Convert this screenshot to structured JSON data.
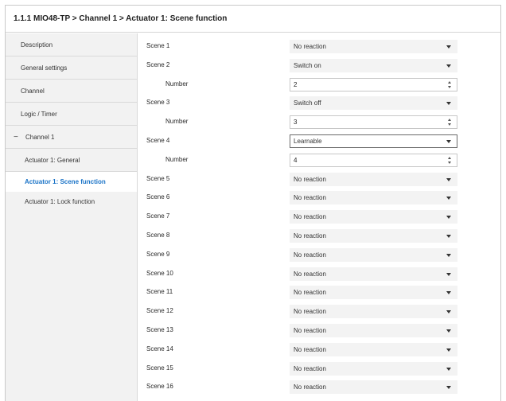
{
  "header": {
    "title": "1.1.1 MIO48-TP > Channel 1 > Actuator 1: Scene function"
  },
  "sidebar": {
    "items": [
      {
        "label": "Description"
      },
      {
        "label": "General settings"
      },
      {
        "label": "Channel"
      },
      {
        "label": "Logic / Timer"
      },
      {
        "label": "Channel 1",
        "collapse_sign": "−"
      },
      {
        "label": "Actuator 1: General"
      },
      {
        "label": "Actuator 1: Scene function",
        "active": true
      },
      {
        "label": "Actuator 1: Lock function"
      }
    ]
  },
  "content": {
    "rows": [
      {
        "label": "Scene 1",
        "type": "select",
        "value": "No reaction"
      },
      {
        "label": "Scene 2",
        "type": "select",
        "value": "Switch on"
      },
      {
        "label": "Number",
        "type": "spin",
        "value": "2"
      },
      {
        "label": "Scene 3",
        "type": "select",
        "value": "Switch off"
      },
      {
        "label": "Number",
        "type": "spin",
        "value": "3"
      },
      {
        "label": "Scene 4",
        "type": "select",
        "value": "Learnable",
        "focused": true
      },
      {
        "label": "Number",
        "type": "spin",
        "value": "4"
      },
      {
        "label": "Scene 5",
        "type": "select",
        "value": "No reaction"
      },
      {
        "label": "Scene 6",
        "type": "select",
        "value": "No reaction"
      },
      {
        "label": "Scene 7",
        "type": "select",
        "value": "No reaction"
      },
      {
        "label": "Scene 8",
        "type": "select",
        "value": "No reaction"
      },
      {
        "label": "Scene 9",
        "type": "select",
        "value": "No reaction"
      },
      {
        "label": "Scene 10",
        "type": "select",
        "value": "No reaction"
      },
      {
        "label": "Scene 11",
        "type": "select",
        "value": "No reaction"
      },
      {
        "label": "Scene 12",
        "type": "select",
        "value": "No reaction"
      },
      {
        "label": "Scene 13",
        "type": "select",
        "value": "No reaction"
      },
      {
        "label": "Scene 14",
        "type": "select",
        "value": "No reaction"
      },
      {
        "label": "Scene 15",
        "type": "select",
        "value": "No reaction"
      },
      {
        "label": "Scene 16",
        "type": "select",
        "value": "No reaction"
      }
    ]
  },
  "colors": {
    "active_link": "#1a73c7",
    "sidebar_bg": "#f2f2f2",
    "select_bg": "#f3f3f3"
  }
}
